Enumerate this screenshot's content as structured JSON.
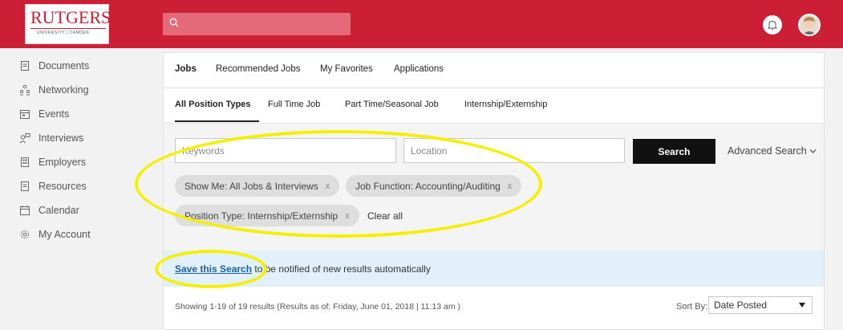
{
  "header": {
    "logo_word": "RUTGERS",
    "logo_sub": "UNIVERSITY | CAMDEN",
    "search_placeholder": ""
  },
  "sidebar": {
    "items": [
      {
        "label": "Documents",
        "icon": "document-icon"
      },
      {
        "label": "Networking",
        "icon": "people-icon"
      },
      {
        "label": "Events",
        "icon": "calendar-icon"
      },
      {
        "label": "Interviews",
        "icon": "interview-icon"
      },
      {
        "label": "Employers",
        "icon": "building-icon"
      },
      {
        "label": "Resources",
        "icon": "document-icon"
      },
      {
        "label": "Calendar",
        "icon": "calendar-icon"
      },
      {
        "label": "My Account",
        "icon": "gear-icon"
      }
    ]
  },
  "tabs_primary": [
    "Jobs",
    "Recommended Jobs",
    "My Favorites",
    "Applications"
  ],
  "tabs_secondary": [
    "All Position Types",
    "Full Time Job",
    "Part Time/Seasonal Job",
    "Internship/Externship"
  ],
  "search": {
    "keyword_placeholder": "Keywords",
    "location_placeholder": "Location",
    "button_label": "Search",
    "advanced_label": "Advanced Search"
  },
  "filters": {
    "pills": [
      "Show Me: All Jobs & Interviews",
      "Job Function: Accounting/Auditing",
      "Position Type: Internship/Externship"
    ],
    "remove_glyph": "x",
    "clear_all": "Clear all"
  },
  "save_search": {
    "link": "Save this Search",
    "rest": " to be notified of new results automatically"
  },
  "results": {
    "showing": "Showing 1-19 of 19 results  (Results as of: Friday, June 01, 2018 | 11:13 am )",
    "sort_label": "Sort By:",
    "sort_value": "Date Posted"
  },
  "colors": {
    "brand_red": "#cc1f36",
    "highlight_yellow": "#f5f000",
    "link_blue": "#1d5fa6",
    "info_band": "#e1f0fa"
  }
}
